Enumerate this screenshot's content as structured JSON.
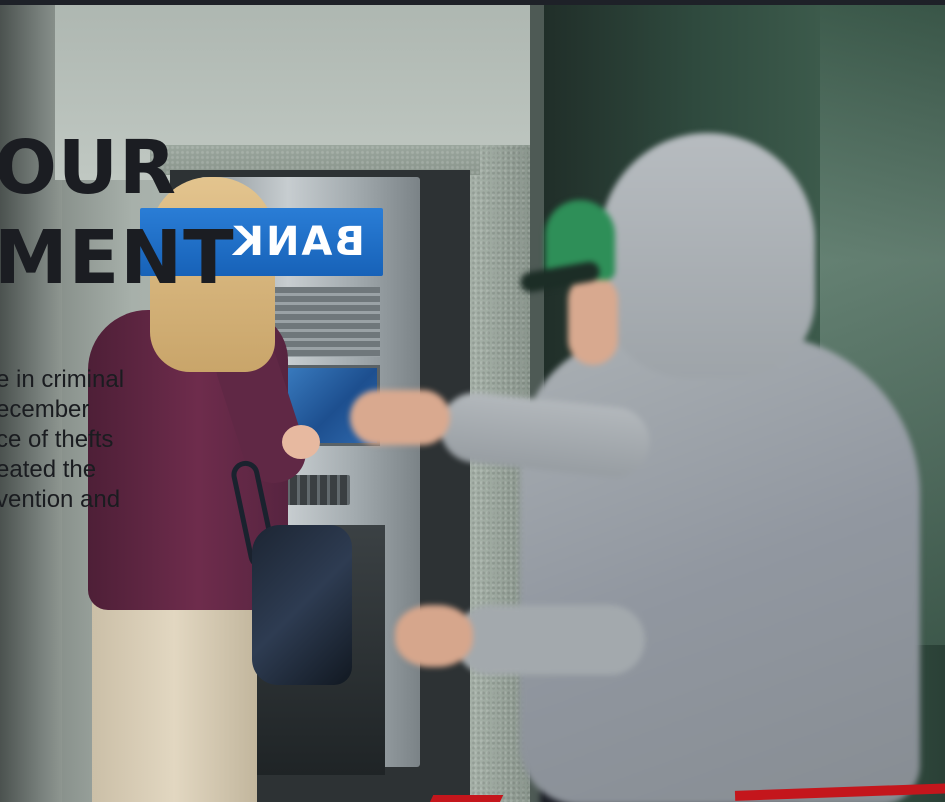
{
  "hero": {
    "headline_lines": [
      "OUR",
      "MENT"
    ],
    "body_lines": [
      "e in criminal",
      "ecember",
      "ce of thefts",
      "eated the",
      "vention and"
    ],
    "atm_sign_text": "BANK"
  },
  "colors": {
    "accent_red": "#c4161c",
    "sign_blue": "#1762b8",
    "text_dark": "#1b1d22"
  }
}
